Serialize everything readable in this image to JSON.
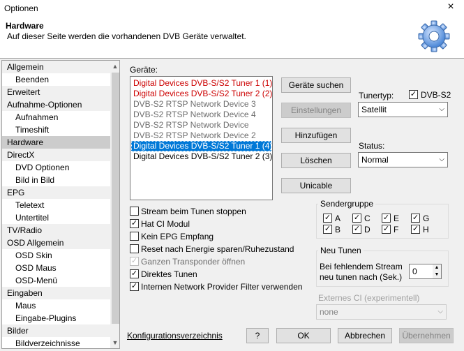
{
  "window": {
    "title": "Optionen",
    "close_icon": "×"
  },
  "header": {
    "title": "Hardware",
    "description": "Auf dieser Seite werden die vorhandenen DVB Geräte verwaltet."
  },
  "sidebar": {
    "items": [
      {
        "label": "Allgemein",
        "kind": "cat"
      },
      {
        "label": "Beenden",
        "kind": "sub"
      },
      {
        "label": "Erweitert",
        "kind": "cat"
      },
      {
        "label": "Aufnahme-Optionen",
        "kind": "cat"
      },
      {
        "label": "Aufnahmen",
        "kind": "sub"
      },
      {
        "label": "Timeshift",
        "kind": "sub"
      },
      {
        "label": "Hardware",
        "kind": "cat",
        "selected": true
      },
      {
        "label": "DirectX",
        "kind": "cat"
      },
      {
        "label": "DVD Optionen",
        "kind": "sub"
      },
      {
        "label": "Bild in Bild",
        "kind": "sub"
      },
      {
        "label": "EPG",
        "kind": "cat"
      },
      {
        "label": "Teletext",
        "kind": "sub"
      },
      {
        "label": "Untertitel",
        "kind": "sub"
      },
      {
        "label": "TV/Radio",
        "kind": "cat"
      },
      {
        "label": "OSD Allgemein",
        "kind": "cat"
      },
      {
        "label": "OSD Skin",
        "kind": "sub"
      },
      {
        "label": "OSD Maus",
        "kind": "sub"
      },
      {
        "label": "OSD-Menü",
        "kind": "sub"
      },
      {
        "label": "Eingaben",
        "kind": "cat"
      },
      {
        "label": "Maus",
        "kind": "sub"
      },
      {
        "label": "Eingabe-Plugins",
        "kind": "sub"
      },
      {
        "label": "Bilder",
        "kind": "cat"
      },
      {
        "label": "Bildverzeichnisse",
        "kind": "sub"
      }
    ]
  },
  "devices": {
    "label": "Geräte:",
    "rows": [
      {
        "label": "Digital Devices DVB-S/S2 Tuner 1 (1)",
        "style": "red"
      },
      {
        "label": "Digital Devices DVB-S/S2 Tuner 2 (2)",
        "style": "red"
      },
      {
        "label": "DVB-S2 RTSP Network Device 3",
        "style": "gray"
      },
      {
        "label": "DVB-S2 RTSP Network Device 4",
        "style": "gray"
      },
      {
        "label": "DVB-S2 RTSP Network Device",
        "style": "gray"
      },
      {
        "label": "DVB-S2 RTSP Network Device 2",
        "style": "gray"
      },
      {
        "label": "Digital Devices DVB-S/S2 Tuner 1 (4)",
        "style": "sel"
      },
      {
        "label": "Digital Devices DVB-S/S2 Tuner 2 (3)",
        "style": "normal"
      }
    ]
  },
  "buttons": {
    "search": "Geräte suchen",
    "settings": "Einstellungen",
    "add": "Hinzufügen",
    "delete": "Löschen",
    "unicable": "Unicable"
  },
  "tuner": {
    "label": "Tunertyp:",
    "dvbs2_label": "DVB-S2",
    "dvbs2_checked": true,
    "value": "Satellit"
  },
  "status": {
    "label": "Status:",
    "value": "Normal"
  },
  "options": [
    {
      "label": "Stream beim Tunen stoppen",
      "checked": false,
      "disabled": false
    },
    {
      "label": "Hat CI Modul",
      "checked": true,
      "disabled": false
    },
    {
      "label": "Kein EPG Empfang",
      "checked": false,
      "disabled": false
    },
    {
      "label": "Reset nach Energie sparen/Ruhezustand",
      "checked": false,
      "disabled": false
    },
    {
      "label": "Ganzen Transponder öffnen",
      "checked": true,
      "disabled": true
    },
    {
      "label": "Direktes Tunen",
      "checked": true,
      "disabled": false
    },
    {
      "label": "Internen Network Provider Filter verwenden",
      "checked": true,
      "disabled": false
    }
  ],
  "sendergruppe": {
    "title": "Sendergruppe",
    "items": [
      {
        "label": "A",
        "checked": true
      },
      {
        "label": "C",
        "checked": true
      },
      {
        "label": "E",
        "checked": true
      },
      {
        "label": "G",
        "checked": true
      },
      {
        "label": "B",
        "checked": true
      },
      {
        "label": "D",
        "checked": true
      },
      {
        "label": "F",
        "checked": true
      },
      {
        "label": "H",
        "checked": true
      }
    ]
  },
  "retune": {
    "title": "Neu Tunen",
    "label_line1": "Bei fehlendem Stream",
    "label_line2": "neu tunen nach (Sek.)",
    "value": "0"
  },
  "external_ci": {
    "label": "Externes CI (experimentell)",
    "value": "none"
  },
  "footer": {
    "config_link": "Konfigurationsverzeichnis",
    "help": "?",
    "ok": "OK",
    "cancel": "Abbrechen",
    "apply": "Übernehmen"
  }
}
